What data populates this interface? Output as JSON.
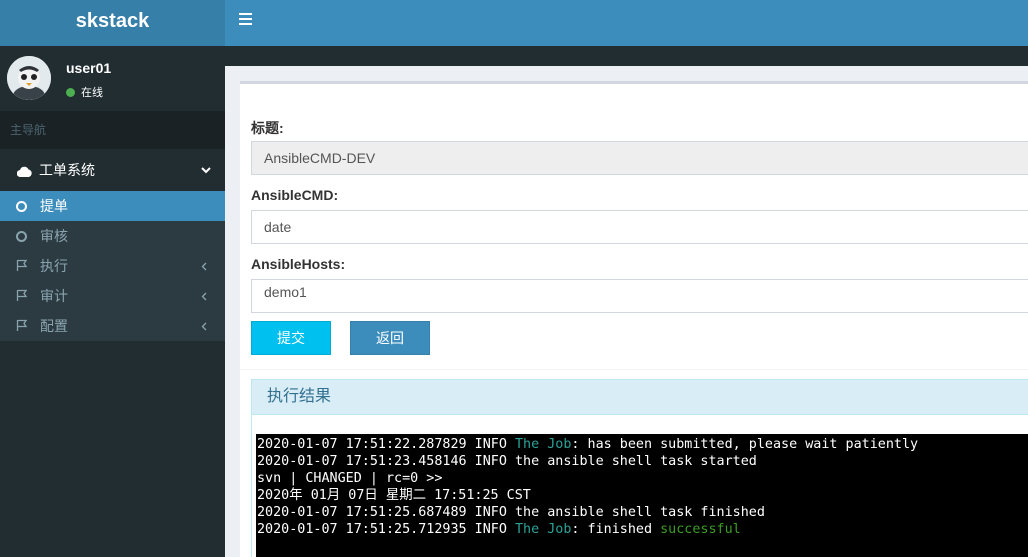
{
  "app": {
    "title": "skstack"
  },
  "user": {
    "name": "user01",
    "status": "在线"
  },
  "sidebar": {
    "header": "主导航",
    "group": {
      "label": "工单系统"
    },
    "items": [
      {
        "label": "提单",
        "icon": "circle-icon",
        "active": true
      },
      {
        "label": "审核",
        "icon": "circle-icon"
      },
      {
        "label": "执行",
        "icon": "flag-icon"
      },
      {
        "label": "审计",
        "icon": "flag-icon"
      },
      {
        "label": "配置",
        "icon": "flag-icon"
      }
    ]
  },
  "form": {
    "title_label": "标题:",
    "title_value": "AnsibleCMD-DEV",
    "cmd_label": "AnsibleCMD:",
    "cmd_value": "date",
    "hosts_label": "AnsibleHosts:",
    "hosts_value": "demo1",
    "submit_label": "提交",
    "back_label": "返回"
  },
  "result": {
    "heading": "执行结果",
    "lines": [
      [
        {
          "t": "2020-01-07 17:51:22.287829 INFO "
        },
        {
          "t": "The Job",
          "c": "teal"
        },
        {
          "t": ": has been submitted, please wait patiently"
        }
      ],
      [
        {
          "t": "2020-01-07 17:51:23.458146 INFO the ansible shell task started"
        }
      ],
      [
        {
          "t": "svn | CHANGED | rc=0 >>"
        }
      ],
      [
        {
          "t": "2020年 01月 07日 星期二 17:51:25 CST"
        }
      ],
      [
        {
          "t": "2020-01-07 17:51:25.687489 INFO the ansible shell task finished"
        }
      ],
      [
        {
          "t": "2020-01-07 17:51:25.712935 INFO "
        },
        {
          "t": "The Job",
          "c": "teal"
        },
        {
          "t": ": finished "
        },
        {
          "t": "successful",
          "c": "green"
        }
      ]
    ]
  },
  "colors": {
    "brand": "#3c8dbc",
    "sidebar": "#222d32",
    "info": "#00c0ef"
  }
}
